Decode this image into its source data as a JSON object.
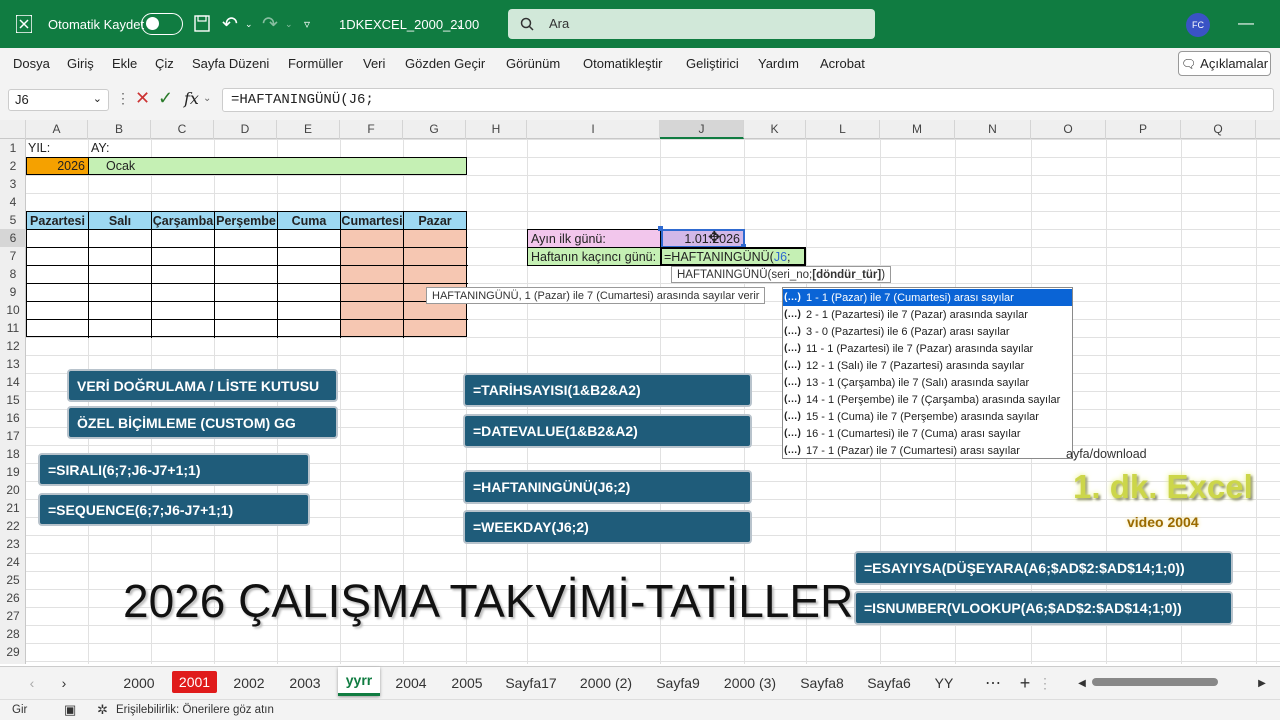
{
  "title_bar": {
    "autosave_label": "Otomatik Kaydet",
    "file_name": "1DKEXCEL_2000_2100",
    "search_placeholder": "Ara",
    "user_initials": "FC"
  },
  "menu": [
    "Dosya",
    "Giriş",
    "Ekle",
    "Çiz",
    "Sayfa Düzeni",
    "Formüller",
    "Veri",
    "Gözden Geçir",
    "Görünüm",
    "Otomatikleştir",
    "Geliştirici",
    "Yardım",
    "Acrobat"
  ],
  "comments_label": "Açıklamalar",
  "formula_bar": {
    "name_box": "J6",
    "formula": "=HAFTANINGÜNÜ(J6;"
  },
  "columns": [
    "A",
    "B",
    "C",
    "D",
    "E",
    "F",
    "G",
    "H",
    "I",
    "J",
    "K",
    "L",
    "M",
    "N",
    "O",
    "P",
    "Q"
  ],
  "rows": [
    "1",
    "2",
    "3",
    "4",
    "5",
    "6",
    "7",
    "8",
    "9",
    "10",
    "11",
    "12",
    "13",
    "14",
    "15",
    "16",
    "17",
    "18",
    "19",
    "20",
    "21",
    "22",
    "23",
    "24",
    "25",
    "26",
    "27",
    "28",
    "29"
  ],
  "cells": {
    "a1": "YIL:",
    "b1": "AY:",
    "a2": "2026",
    "b2": "Ocak",
    "i6": "Ayın ilk günü:",
    "j6": "1.01.2026",
    "i7": "Haftanın kaçıncı günü:",
    "j7_prefix": "=HAFTANINGÜNÜ(",
    "j7_ref": "J6",
    "j7_suffix": ";"
  },
  "weekdays": [
    "Pazartesi",
    "Salı",
    "Çarşamba",
    "Perşembe",
    "Cuma",
    "Cumartesi",
    "Pazar"
  ],
  "buttons": {
    "veri": "VERİ DOĞRULAMA / LİSTE KUTUSU",
    "ozel": "ÖZEL BİÇİMLEME (CUSTOM)   GG",
    "sirali": "=SIRALI(6;7;J6-J7+1;1)",
    "sequence": "=SEQUENCE(6;7;J6-J7+1;1)",
    "tarih": "=TARİHSAYISI(1&B2&A2)",
    "datevalue": "=DATEVALUE(1&B2&A2)",
    "haftaningunu": "=HAFTANINGÜNÜ(J6;2)",
    "weekday": "=WEEKDAY(J6;2)",
    "esayiysa": "=ESAYIYSA(DÜŞEYARA(A6;$AD$2:$AD$14;1;0))",
    "isnumber": "=ISNUMBER(VLOOKUP(A6;$AD$2:$AD$14;1;0))"
  },
  "banner": "2026 ÇALIŞMA TAKVİMİ-TATİLLER",
  "brand": {
    "name": "1. dk. Excel",
    "video": "video 2004",
    "download_text": "ayfa/download"
  },
  "tooltips": {
    "syntax_fn": "HAFTANINGÜNÜ(seri_no; ",
    "syntax_arg": "[döndür_tür]",
    "syntax_end": ")",
    "desc": "HAFTANINGÜNÜ, 1 (Pazar) ile 7 (Cumartesi) arasında sayılar verir"
  },
  "dropdown": [
    "1 - 1 (Pazar) ile 7 (Cumartesi) arası sayılar",
    "2 - 1 (Pazartesi) ile 7 (Pazar) arasında sayılar",
    "3 - 0 (Pazartesi) ile 6 (Pazar) arası sayılar",
    "11 - 1 (Pazartesi) ile 7 (Pazar) arasında sayılar",
    "12 - 1 (Salı) ile 7 (Pazartesi) arasında sayılar",
    "13 - 1 (Çarşamba) ile 7 (Salı) arasında sayılar",
    "14 - 1 (Perşembe) ile 7 (Çarşamba) arasında sayılar",
    "15 - 1 (Cuma) ile 7 (Perşembe) arasında sayılar",
    "16 - 1 (Cumartesi) ile 7 (Cuma) arası sayılar",
    "17 - 1 (Pazar) ile 7 (Cumartesi) arası sayılar"
  ],
  "sheet_tabs": [
    "2000",
    "2001",
    "2002",
    "2003",
    "yyrr",
    "2004",
    "2005",
    "Sayfa17",
    "2000 (2)",
    "Sayfa9",
    "2000 (3)",
    "Sayfa8",
    "Sayfa6",
    "YY"
  ],
  "active_tab": "yyrr",
  "status": {
    "mode": "Gir",
    "accessibility": "Erişilebilirlik: Önerilere göz atın"
  },
  "colors": {
    "excel_green": "#107c41",
    "box_blue": "#1f5c7a",
    "selected_item": "#0a64d6",
    "highlight_green": "#c5f0b4",
    "header_blue": "#9dd8f2",
    "weekend": "#f6c7b2",
    "year_orange": "#f5a100"
  }
}
